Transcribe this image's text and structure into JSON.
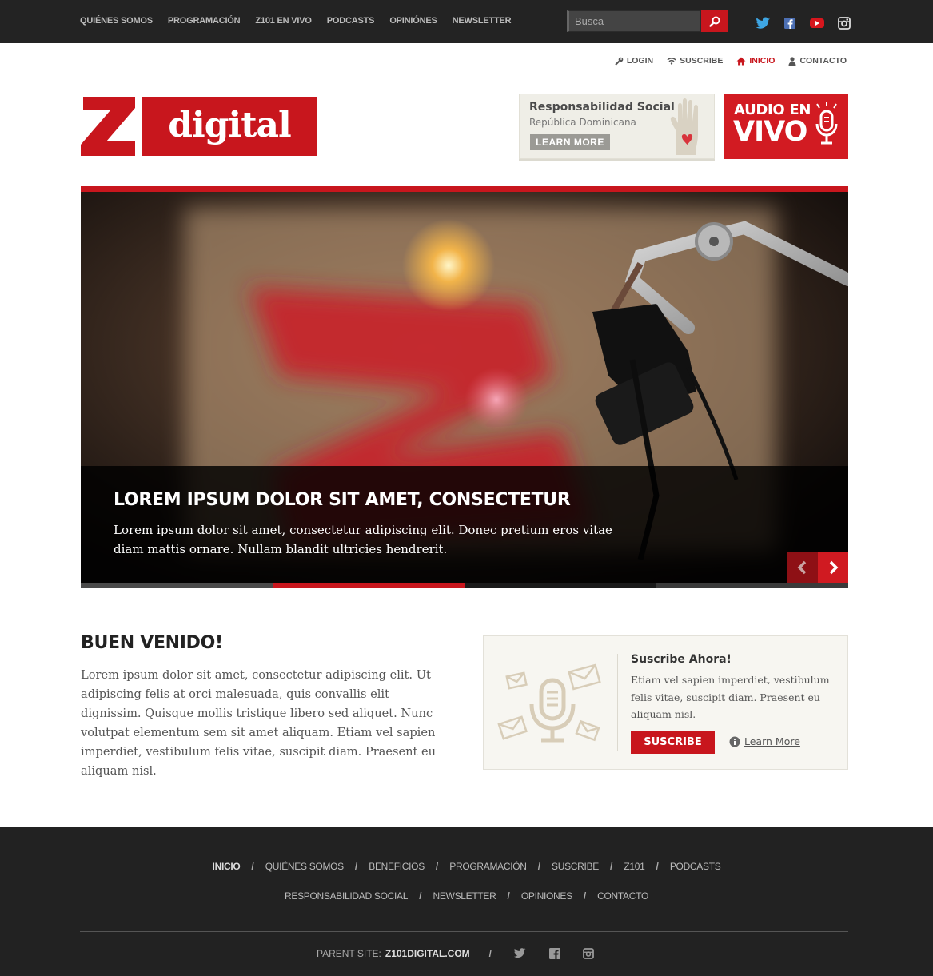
{
  "topnav": {
    "items": [
      "QUIÉNES SOMOS",
      "PROGRAMACIÓN",
      "Z101 EN VIVO",
      "PODCASTS",
      "OPINIÓNES",
      "NEWSLETTER"
    ],
    "search_placeholder": "Busca"
  },
  "social_icons": [
    "twitter-icon",
    "facebook-icon",
    "youtube-icon",
    "instagram-icon"
  ],
  "utility": {
    "login": "LOGIN",
    "suscribe": "SUSCRIBE",
    "inicio": "INICIO",
    "contacto": "CONTACTO"
  },
  "logo": {
    "letter": "Z",
    "word": "digital"
  },
  "resp_social": {
    "title": "Responsabilidad Social",
    "subtitle": "República Dominicana",
    "button": "LEARN MORE"
  },
  "audio": {
    "line1": "AUDIO EN",
    "line2": "VIVO"
  },
  "slider": {
    "title": "LOREM IPSUM DOLOR SIT AMET, CONSECTETUR",
    "text": "Lorem ipsum dolor sit amet, consectetur adipiscing elit. Donec pretium eros vitae diam mattis ornare. Nullam blandit ultricies hendrerit.",
    "active_slide": 2,
    "slide_count": 4
  },
  "welcome": {
    "title": "BUEN VENIDO!",
    "text": "Lorem ipsum dolor sit amet, consectetur adipiscing elit. Ut adipiscing felis at orci malesuada, quis convallis elit dignissim. Quisque mollis tristique libero sed aliquet. Nunc volutpat elementum sem sit amet aliquam. Etiam vel sapien imperdiet, vestibulum felis vitae, suscipit diam. Praesent eu aliquam nisl."
  },
  "subscribe": {
    "title": "Suscribe Ahora!",
    "text": "Etiam vel sapien imperdiet, vestibulum felis vitae, suscipit diam. Praesent eu aliquam nisl.",
    "button": "SUSCRIBE",
    "learn_more": "Learn More"
  },
  "footer": {
    "row1": [
      "INICIO",
      "QUIÉNES SOMOS",
      "BENEFICIOS",
      "PROGRAMACIÓN",
      "SUSCRIBE",
      "Z101",
      "PODCASTS"
    ],
    "row2": [
      "RESPONSABILIDAD SOCIAL",
      "NEWSLETTER",
      "OPINIONES",
      "CONTACTO"
    ],
    "separator": "/",
    "parent_label": "PARENT SITE:",
    "parent_site": "Z101DIGITAL.COM"
  },
  "colors": {
    "brand_red": "#c8161d",
    "dark": "#232323",
    "footer": "#222222"
  }
}
